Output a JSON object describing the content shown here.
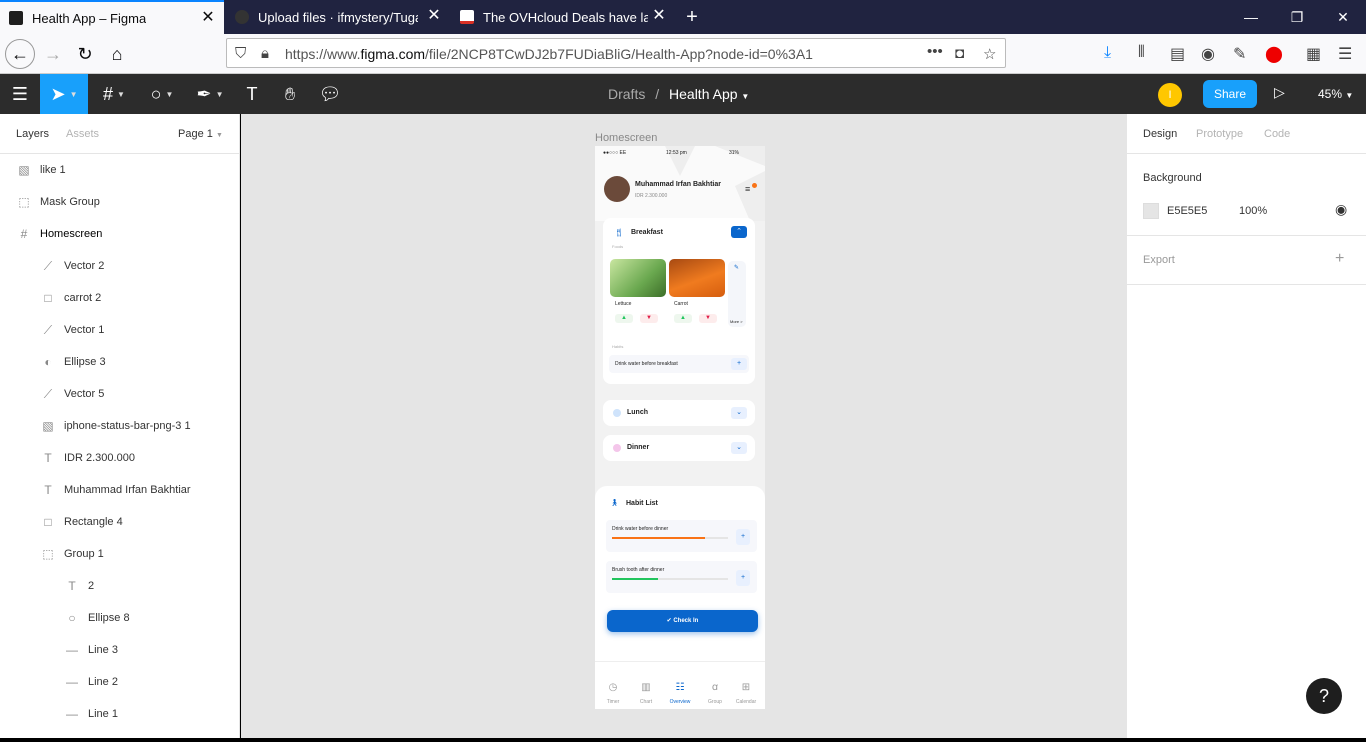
{
  "browser": {
    "tabs": [
      {
        "label": "Health App – Figma",
        "active": true
      },
      {
        "label": "Upload files · ifmystery/Tugas_",
        "active": false
      },
      {
        "label": "The OVHcloud Deals have land",
        "active": false
      }
    ],
    "new_tab": "+",
    "url_prefix": "https://www.",
    "url_domain": "figma.com",
    "url_path": "/file/2NCP8TCwDJ2b7FUDiaBliG/Health-App?node-id=0%3A1"
  },
  "figma": {
    "breadcrumb_parent": "Drafts",
    "breadcrumb_sep": "/",
    "file_name": "Health App",
    "avatar_initial": "I",
    "share_label": "Share",
    "zoom_label": "45%",
    "left_tabs": {
      "layers": "Layers",
      "assets": "Assets",
      "page": "Page 1"
    },
    "layers": [
      {
        "name": "like 1",
        "icon": "image-icon"
      },
      {
        "name": "Mask Group",
        "icon": "group-icon"
      },
      {
        "name": "Homescreen",
        "icon": "frame-icon"
      },
      {
        "name": "Vector 2",
        "icon": "vector-icon"
      },
      {
        "name": "carrot 2",
        "icon": "rectangle-icon"
      },
      {
        "name": "Vector 1",
        "icon": "vector-icon"
      },
      {
        "name": "Ellipse 3",
        "icon": "mask-icon"
      },
      {
        "name": "Vector 5",
        "icon": "vector-icon"
      },
      {
        "name": "iphone-status-bar-png-3 1",
        "icon": "image-icon"
      },
      {
        "name": "IDR 2.300.000",
        "icon": "text-icon"
      },
      {
        "name": "Muhammad Irfan Bakhtiar",
        "icon": "text-icon"
      },
      {
        "name": "Rectangle 4",
        "icon": "rectangle-icon"
      },
      {
        "name": "Group 1",
        "icon": "group-icon"
      },
      {
        "name": "2",
        "icon": "text-icon"
      },
      {
        "name": "Ellipse 8",
        "icon": "ellipse-icon"
      },
      {
        "name": "Line 3",
        "icon": "line-icon"
      },
      {
        "name": "Line 2",
        "icon": "line-icon"
      },
      {
        "name": "Line 1",
        "icon": "line-icon"
      }
    ],
    "right_tabs": {
      "design": "Design",
      "prototype": "Prototype",
      "code": "Code"
    },
    "background_label": "Background",
    "background_hex": "E5E5E5",
    "background_opacity": "100%",
    "export_label": "Export",
    "frame_label": "Homescreen",
    "help": "?"
  },
  "phone": {
    "status_left": "●●○○○ EE",
    "status_time": "12:53 pm",
    "status_batt": "31%",
    "user_name": "Muhammad Irfan Bakhtiar",
    "balance": "IDR 2.300.000",
    "breakfast": "Breakfast",
    "foods_label": "Foods",
    "lettuce": "Lettuce",
    "carrot": "Carrot",
    "more": "More >",
    "habits_label": "Habits",
    "breakfast_habit": "Drink water before breakfast",
    "lunch": "Lunch",
    "dinner": "Dinner",
    "habit_list": "Habit List",
    "habit1": "Drink water before dinner",
    "habit1_progress": 0.8,
    "habit2": "Brush tooth after dinner",
    "habit2_progress": 0.4,
    "checkin": "Check In",
    "nav": [
      "Timer",
      "Chart",
      "Overview",
      "Group",
      "Calendar"
    ]
  },
  "colors": {
    "figma_blue": "#18A0FB",
    "accent_blue": "#0A66CC",
    "progress_orange": "#F97316",
    "progress_green": "#22C55E"
  }
}
